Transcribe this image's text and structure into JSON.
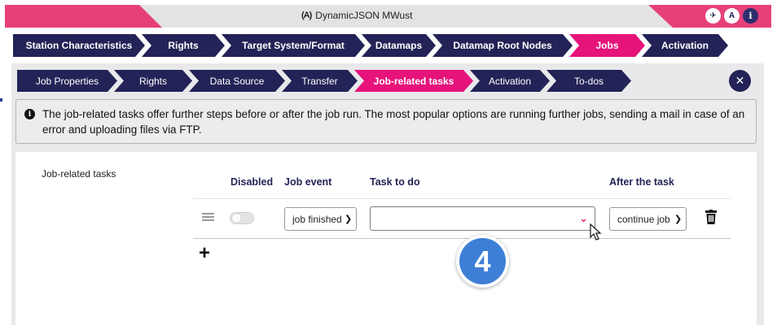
{
  "window": {
    "title": "DynamicJSON MWust",
    "antenna_glyph": "(A)",
    "buttons": {
      "plane": "✈",
      "antenna": "A",
      "info": "i"
    }
  },
  "outer_tabs": [
    {
      "label": "Station Characteristics",
      "active": false
    },
    {
      "label": "Rights",
      "active": false
    },
    {
      "label": "Target System/Format",
      "active": false
    },
    {
      "label": "Datamaps",
      "active": false
    },
    {
      "label": "Datamap Root Nodes",
      "active": false
    },
    {
      "label": "Jobs",
      "active": true
    },
    {
      "label": "Activation",
      "active": false
    }
  ],
  "inner_tabs": [
    {
      "label": "Job Properties",
      "active": false
    },
    {
      "label": "Rights",
      "active": false
    },
    {
      "label": "Data Source",
      "active": false
    },
    {
      "label": "Transfer",
      "active": false
    },
    {
      "label": "Job-related tasks",
      "active": true
    },
    {
      "label": "Activation",
      "active": false
    },
    {
      "label": "To-dos",
      "active": false
    }
  ],
  "info": {
    "text": "The job-related tasks offer further steps before or after the job run. The most popular options are running further jobs, sending a mail in case of an error and uploading files via FTP."
  },
  "section": {
    "label": "Job-related tasks"
  },
  "columns": {
    "disabled": "Disabled",
    "job_event": "Job event",
    "task": "Task to do",
    "after": "After the task"
  },
  "row": {
    "disabled": false,
    "job_event": "job finished",
    "task": "",
    "after": "continue job"
  },
  "add_label": "+",
  "step_badge": "4",
  "colors": {
    "navy": "#232357",
    "accent": "#e6137a",
    "title_pink": "#e6407a",
    "badge_blue": "#3d7fd6"
  }
}
